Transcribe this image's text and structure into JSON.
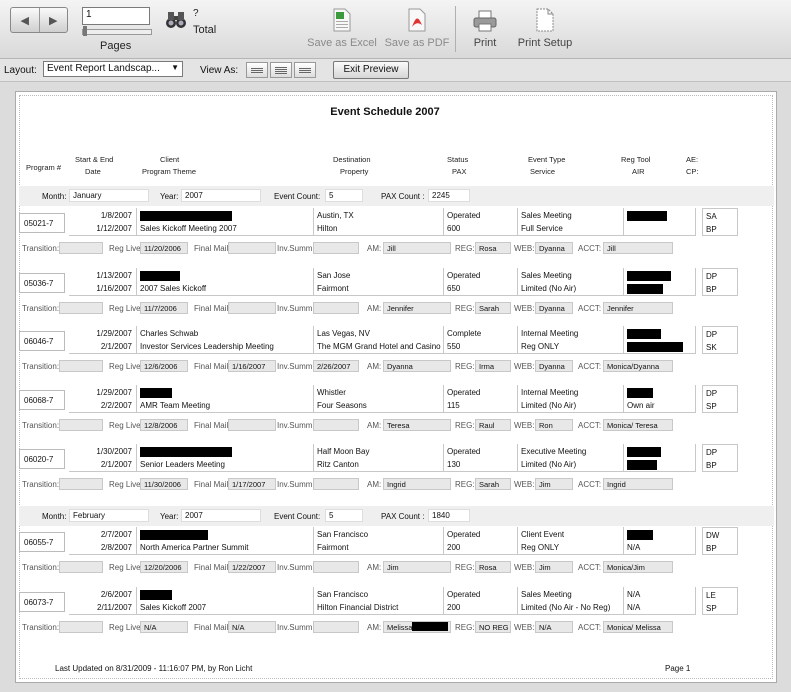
{
  "toolbar": {
    "page_value": "1",
    "pages_label": "Pages",
    "total_value": "?",
    "total_label": "Total",
    "excel_label": "Save as Excel",
    "pdf_label": "Save as PDF",
    "print_label": "Print",
    "setup_label": "Print Setup"
  },
  "bar2": {
    "layout_label": "Layout:",
    "layout_value": "Event Report Landscap...",
    "viewas_label": "View As:",
    "exit_label": "Exit Preview"
  },
  "report": {
    "title": "Event Schedule  2007",
    "headers": {
      "program": "Program #",
      "start_end": "Start & End",
      "date": "Date",
      "client": "Client",
      "theme": "Program Theme",
      "destination": "Destination",
      "property": "Property",
      "status": "Status",
      "pax": "PAX",
      "event_type": "Event Type",
      "service": "Service",
      "reg_tool": "Reg Tool",
      "air": "AIR",
      "ae": "AE:",
      "cp": "CP:"
    },
    "labels": {
      "month": "Month:",
      "year": "Year:",
      "event_count": "Event Count:",
      "pax_count": "PAX Count :",
      "transition": "Transition:",
      "reg_live": "Reg Live:",
      "final_mail": "Final Mail:",
      "inv_summ": "Inv.Summ:",
      "am": "AM:",
      "reg": "REG:",
      "web": "WEB:",
      "acct": "ACCT:"
    },
    "months": [
      {
        "month": "January",
        "year": "2007",
        "event_count": "5",
        "pax_count": "2245"
      },
      {
        "month": "February",
        "year": "2007",
        "event_count": "5",
        "pax_count": "1840"
      }
    ],
    "events": [
      {
        "program": "05021-7",
        "start": "1/8/2007",
        "end": "1/12/2007",
        "client": "",
        "theme": "Sales Kickoff Meeting 2007",
        "destination": "Austin, TX",
        "property": "Hilton",
        "status": "Operated",
        "pax": "600",
        "event_type": "Sales Meeting",
        "service": "Full Service",
        "reg_tool": "",
        "air": "",
        "ae": "SA",
        "cp": "BP",
        "reg_live": "11/20/2006",
        "final_mail": "",
        "inv_summ": "",
        "am": "Jill",
        "reg": "Rosa",
        "web": "Dyanna",
        "acct": "Jill"
      },
      {
        "program": "05036-7",
        "start": "1/13/2007",
        "end": "1/16/2007",
        "client": "",
        "theme": "2007 Sales Kickoff",
        "destination": "San Jose",
        "property": "Fairmont",
        "status": "Operated",
        "pax": "650",
        "event_type": "Sales Meeting",
        "service": "Limited (No Air)",
        "reg_tool": "",
        "air": "",
        "ae": "DP",
        "cp": "BP",
        "reg_live": "11/7/2006",
        "final_mail": "",
        "inv_summ": "",
        "am": "Jennifer",
        "reg": "Sarah",
        "web": "Dyanna",
        "acct": "Jennifer"
      },
      {
        "program": "06046-7",
        "start": "1/29/2007",
        "end": "2/1/2007",
        "client": "Charles Schwab",
        "theme": "Investor Services Leadership Meeting",
        "destination": "Las Vegas, NV",
        "property": "The MGM Grand Hotel and Casino",
        "status": "Complete",
        "pax": "550",
        "event_type": "Internal Meeting",
        "service": "Reg ONLY",
        "reg_tool": "",
        "air": "",
        "ae": "DP",
        "cp": "SK",
        "reg_live": "12/6/2006",
        "final_mail": "1/16/2007",
        "inv_summ": "2/26/2007",
        "am": "Dyanna",
        "reg": "Irma",
        "web": "Dyanna",
        "acct": "Monica/Dyanna"
      },
      {
        "program": "06068-7",
        "start": "1/29/2007",
        "end": "2/2/2007",
        "client": "",
        "theme": "AMR Team Meeting",
        "destination": "Whistler",
        "property": "Four Seasons",
        "status": "Operated",
        "pax": "115",
        "event_type": "Internal Meeting",
        "service": "Limited (No Air)",
        "reg_tool": "",
        "air": "Own air",
        "ae": "DP",
        "cp": "SP",
        "reg_live": "12/8/2006",
        "final_mail": "",
        "inv_summ": "",
        "am": "Teresa",
        "reg": "Raul",
        "web": "Ron",
        "acct": "Monica/ Teresa"
      },
      {
        "program": "06020-7",
        "start": "1/30/2007",
        "end": "2/1/2007",
        "client": "",
        "theme": "Senior Leaders Meeting",
        "destination": "Half Moon Bay",
        "property": "Ritz Canton",
        "status": "Operated",
        "pax": "130",
        "event_type": "Executive Meeting",
        "service": "Limited (No Air)",
        "reg_tool": "",
        "air": "",
        "ae": "DP",
        "cp": "BP",
        "reg_live": "11/30/2006",
        "final_mail": "1/17/2007",
        "inv_summ": "",
        "am": "Ingrid",
        "reg": "Sarah",
        "web": "Jim",
        "acct": "Ingrid"
      },
      {
        "program": "06055-7",
        "start": "2/7/2007",
        "end": "2/8/2007",
        "client": "",
        "theme": "North America Partner Summit",
        "destination": "San Francisco",
        "property": "Fairmont",
        "status": "Operated",
        "pax": "200",
        "event_type": "Client Event",
        "service": "Reg ONLY",
        "reg_tool": "",
        "air": "N/A",
        "ae": "DW",
        "cp": "BP",
        "reg_live": "12/20/2006",
        "final_mail": "1/22/2007",
        "inv_summ": "",
        "am": "Jim",
        "reg": "Rosa",
        "web": "Jim",
        "acct": "Monica/Jim"
      },
      {
        "program": "06073-7",
        "start": "2/6/2007",
        "end": "2/11/2007",
        "client": "",
        "theme": "Sales Kickoff 2007",
        "destination": "San Francisco",
        "property": "Hilton Financial District",
        "status": "Operated",
        "pax": "200",
        "event_type": "Sales Meeting",
        "service": "Limited (No Air - No Reg)",
        "reg_tool": "N/A",
        "air": "N/A",
        "ae": "LE",
        "cp": "SP",
        "reg_live": "N/A",
        "final_mail": "N/A",
        "inv_summ": "",
        "am": "Melissa",
        "reg": "NO REG",
        "web": "N/A",
        "acct": "Monica/ Melissa"
      }
    ],
    "footer_left": "Last Updated on 8/31/2009 - 11:16:07 PM, by Ron Licht",
    "footer_right": "Page 1"
  }
}
